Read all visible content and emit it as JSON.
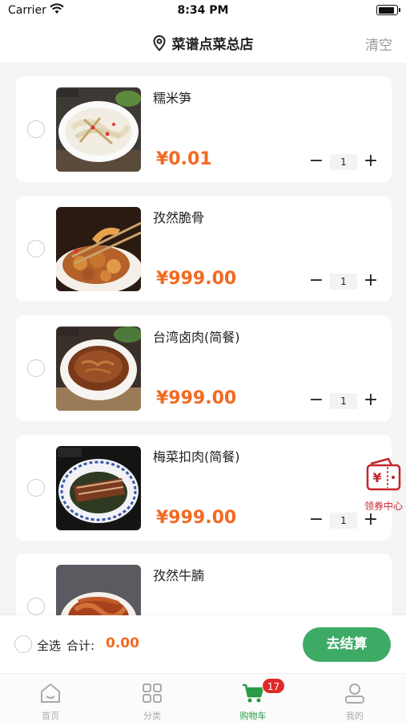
{
  "status_bar": {
    "carrier": "Carrier",
    "time": "8:34 PM"
  },
  "nav": {
    "title": "菜谱点菜总店",
    "clear": "清空"
  },
  "items": [
    {
      "name": "糯米笋",
      "price": "¥0.01",
      "qty": "1"
    },
    {
      "name": "孜然脆骨",
      "price": "¥999.00",
      "qty": "1"
    },
    {
      "name": "台湾卤肉(简餐)",
      "price": "¥999.00",
      "qty": "1"
    },
    {
      "name": "梅菜扣肉(简餐)",
      "price": "¥999.00",
      "qty": "1"
    },
    {
      "name": "孜然牛腩",
      "price": "",
      "qty": ""
    }
  ],
  "stepper": {
    "minus": "−",
    "plus": "+"
  },
  "coupon": {
    "label": "领券中心"
  },
  "checkout": {
    "select_all": "全选",
    "total_label": "合计:",
    "total_value": "0.00",
    "button": "去结算"
  },
  "tabs": [
    {
      "label": "首页",
      "icon": "home-icon"
    },
    {
      "label": "分类",
      "icon": "grid-icon"
    },
    {
      "label": "购物车",
      "icon": "cart-icon",
      "badge": "17"
    },
    {
      "label": "我的",
      "icon": "user-icon"
    }
  ],
  "colors": {
    "accent_green": "#3dab65",
    "price_orange": "#f26a21",
    "badge_red": "#e02a2a",
    "coupon_red": "#c6242a"
  }
}
